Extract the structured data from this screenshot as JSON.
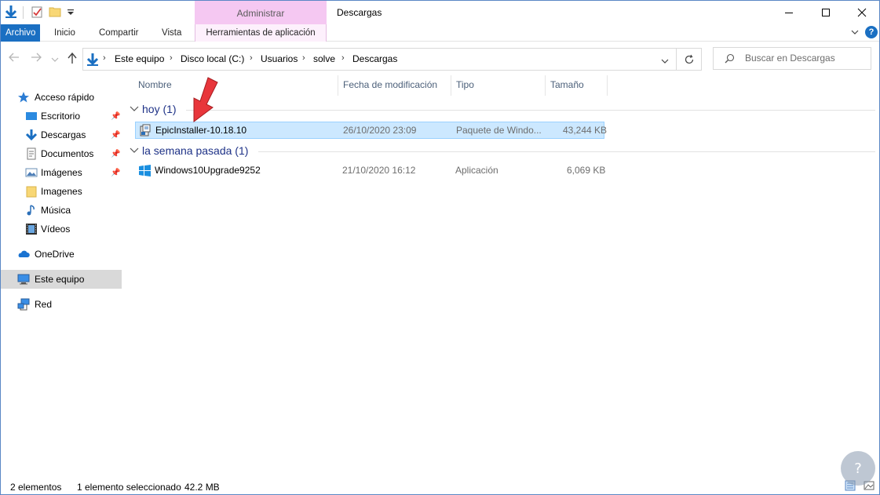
{
  "window": {
    "title": "Descargas",
    "context_group": "Administrar"
  },
  "ribbon": {
    "tabs": [
      {
        "label": "Archivo"
      },
      {
        "label": "Inicio"
      },
      {
        "label": "Compartir"
      },
      {
        "label": "Vista"
      },
      {
        "label": "Herramientas de aplicación"
      }
    ]
  },
  "address": {
    "breadcrumbs": [
      "Este equipo",
      "Disco local (C:)",
      "Usuarios",
      "solve",
      "Descargas"
    ]
  },
  "search": {
    "placeholder": "Buscar en Descargas"
  },
  "nav": {
    "quick_access": "Acceso rápido",
    "items": [
      {
        "label": "Escritorio",
        "pinned": true
      },
      {
        "label": "Descargas",
        "pinned": true
      },
      {
        "label": "Documentos",
        "pinned": true
      },
      {
        "label": "Imágenes",
        "pinned": true
      },
      {
        "label": "Imagenes",
        "pinned": false
      },
      {
        "label": "Música",
        "pinned": false
      },
      {
        "label": "Vídeos",
        "pinned": false
      }
    ],
    "onedrive": "OneDrive",
    "this_pc": "Este equipo",
    "network": "Red"
  },
  "columns": {
    "name": "Nombre",
    "modified": "Fecha de modificación",
    "type": "Tipo",
    "size": "Tamaño"
  },
  "groups": [
    {
      "label": "hoy (1)",
      "files": [
        {
          "name": "EpicInstaller-10.18.10",
          "modified": "26/10/2020 23:09",
          "type": "Paquete de Windo...",
          "size": "43,244 KB",
          "selected": true
        }
      ]
    },
    {
      "label": "la semana pasada (1)",
      "files": [
        {
          "name": "Windows10Upgrade9252",
          "modified": "21/10/2020 16:12",
          "type": "Aplicación",
          "size": "6,069 KB",
          "selected": false
        }
      ]
    }
  ],
  "status": {
    "count": "2 elementos",
    "selection": "1 elemento seleccionado",
    "selection_size": "42.2 MB"
  },
  "colors": {
    "accent": "#1a6fc2",
    "context_tab": "#f5c8f2",
    "selection": "#cce8ff",
    "group_header": "#1e3287",
    "annotation_arrow": "#e8363b"
  }
}
